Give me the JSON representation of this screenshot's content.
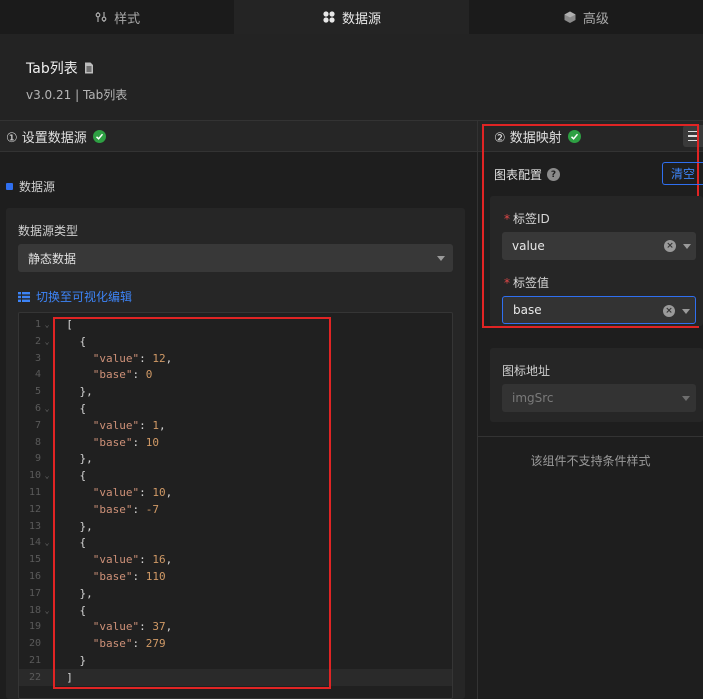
{
  "tabs": [
    {
      "label": "样式",
      "icon": "sliders-icon",
      "active": false
    },
    {
      "label": "数据源",
      "icon": "database-icon",
      "active": true
    },
    {
      "label": "高级",
      "icon": "cube-icon",
      "active": false
    }
  ],
  "component": {
    "title": "Tab列表",
    "title_icon": "document-icon",
    "subtitle": "v3.0.21 | Tab列表"
  },
  "left_section": {
    "step_title": "① 设置数据源",
    "status_icon": "check-circle-icon",
    "datasource_label": "数据源",
    "type_label": "数据源类型",
    "type_value": "静态数据",
    "switch_link": "切换至可视化编辑",
    "code_lines": [
      {
        "num": "1",
        "fold": true,
        "text": "  ["
      },
      {
        "num": "2",
        "fold": true,
        "text": "    {"
      },
      {
        "num": "3",
        "fold": false,
        "key": "\"value\"",
        "val": "12",
        "comma": true
      },
      {
        "num": "4",
        "fold": false,
        "key": "\"base\"",
        "val": "0",
        "comma": false
      },
      {
        "num": "5",
        "fold": false,
        "text": "    },"
      },
      {
        "num": "6",
        "fold": true,
        "text": "    {"
      },
      {
        "num": "7",
        "fold": false,
        "key": "\"value\"",
        "val": "1",
        "comma": true
      },
      {
        "num": "8",
        "fold": false,
        "key": "\"base\"",
        "val": "10",
        "comma": false
      },
      {
        "num": "9",
        "fold": false,
        "text": "    },"
      },
      {
        "num": "10",
        "fold": true,
        "text": "    {"
      },
      {
        "num": "11",
        "fold": false,
        "key": "\"value\"",
        "val": "10",
        "comma": true
      },
      {
        "num": "12",
        "fold": false,
        "key": "\"base\"",
        "val": "-7",
        "comma": false
      },
      {
        "num": "13",
        "fold": false,
        "text": "    },"
      },
      {
        "num": "14",
        "fold": true,
        "text": "    {"
      },
      {
        "num": "15",
        "fold": false,
        "key": "\"value\"",
        "val": "16",
        "comma": true
      },
      {
        "num": "16",
        "fold": false,
        "key": "\"base\"",
        "val": "110",
        "comma": false
      },
      {
        "num": "17",
        "fold": false,
        "text": "    },"
      },
      {
        "num": "18",
        "fold": true,
        "text": "    {"
      },
      {
        "num": "19",
        "fold": false,
        "key": "\"value\"",
        "val": "37",
        "comma": true
      },
      {
        "num": "20",
        "fold": false,
        "key": "\"base\"",
        "val": "279",
        "comma": false
      },
      {
        "num": "21",
        "fold": false,
        "text": "    }"
      },
      {
        "num": "22",
        "fold": false,
        "text": "  ]"
      }
    ]
  },
  "right_section": {
    "step_title": "② 数据映射",
    "status_icon": "check-circle-icon",
    "config_label": "图表配置",
    "clear_label": "清空",
    "fields": [
      {
        "label": "标签ID",
        "value": "value",
        "required": true
      },
      {
        "label": "标签值",
        "value": "base",
        "required": true
      }
    ],
    "icon_field_label": "图标地址",
    "icon_field_placeholder": "imgSrc",
    "no_condition_text": "该组件不支持条件样式"
  },
  "colors": {
    "accent": "#2f6ff0",
    "success": "#2ea043",
    "highlight_box": "#e02424"
  }
}
